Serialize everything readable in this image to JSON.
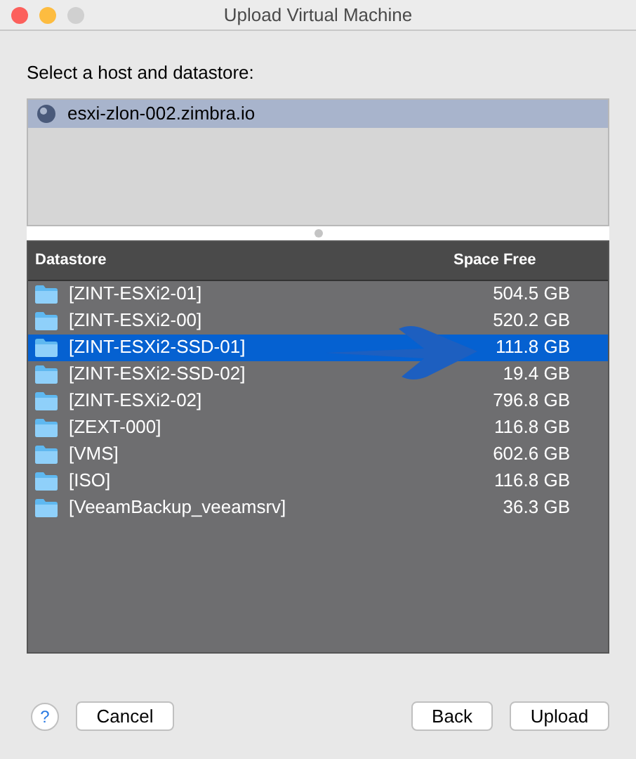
{
  "window": {
    "title": "Upload Virtual Machine"
  },
  "prompt": "Select a host and datastore:",
  "hosts": [
    {
      "name": "esxi-zlon-002.zimbra.io",
      "selected": true
    }
  ],
  "table": {
    "columns": [
      "Datastore",
      "Space Free"
    ],
    "rows": [
      {
        "name": "[ZINT-ESXi2-01]",
        "free": "504.5 GB",
        "selected": false
      },
      {
        "name": "[ZINT-ESXi2-00]",
        "free": "520.2 GB",
        "selected": false
      },
      {
        "name": "[ZINT-ESXi2-SSD-01]",
        "free": "111.8 GB",
        "selected": true
      },
      {
        "name": "[ZINT-ESXi2-SSD-02]",
        "free": "19.4 GB",
        "selected": false
      },
      {
        "name": "[ZINT-ESXi2-02]",
        "free": "796.8 GB",
        "selected": false
      },
      {
        "name": "[ZEXT-000]",
        "free": "116.8 GB",
        "selected": false
      },
      {
        "name": "[VMS]",
        "free": "602.6 GB",
        "selected": false
      },
      {
        "name": "[ISO]",
        "free": "116.8 GB",
        "selected": false
      },
      {
        "name": "[VeeamBackup_veeamsrv]",
        "free": "36.3 GB",
        "selected": false
      }
    ]
  },
  "buttons": {
    "help": "?",
    "cancel": "Cancel",
    "back": "Back",
    "upload": "Upload"
  }
}
